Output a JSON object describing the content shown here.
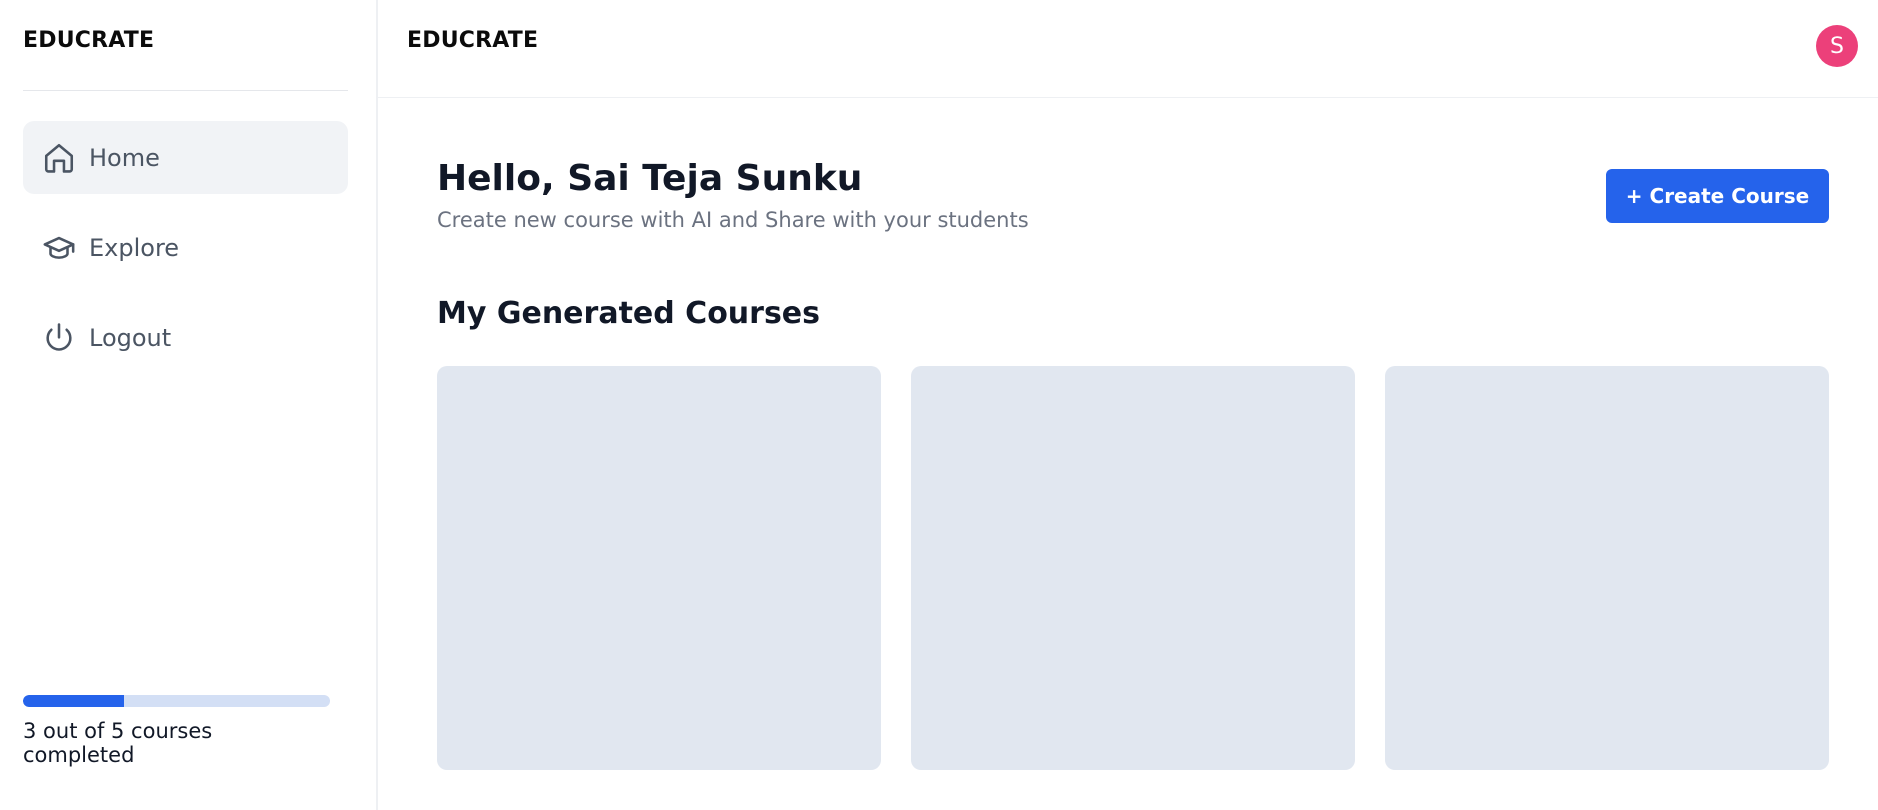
{
  "sidebar": {
    "logo": "EDUCRATE",
    "nav": [
      {
        "label": "Home",
        "icon": "home-icon",
        "active": true
      },
      {
        "label": "Explore",
        "icon": "graduation-cap-icon",
        "active": false
      },
      {
        "label": "Logout",
        "icon": "power-icon",
        "active": false
      }
    ],
    "progress": {
      "completed": 3,
      "total": 5,
      "fraction": 0.33,
      "text": "3 out of 5 courses completed"
    }
  },
  "header": {
    "logo": "EDUCRATE",
    "avatar_initial": "S",
    "avatar_color": "#ec407a"
  },
  "main": {
    "greeting_prefix": "Hello,",
    "user_name": "Sai Teja Sunku",
    "subtitle": "Create new course with AI and Share with your students",
    "create_button_label": "+ Create Course",
    "section_title": "My Generated Courses",
    "course_cards": [
      {
        "state": "loading-placeholder"
      },
      {
        "state": "loading-placeholder"
      },
      {
        "state": "loading-placeholder"
      }
    ]
  },
  "colors": {
    "accent": "#2563eb",
    "progress_track": "#d3dff5",
    "active_nav_bg": "#f1f3f6",
    "card_placeholder": "#e1e7f0"
  }
}
